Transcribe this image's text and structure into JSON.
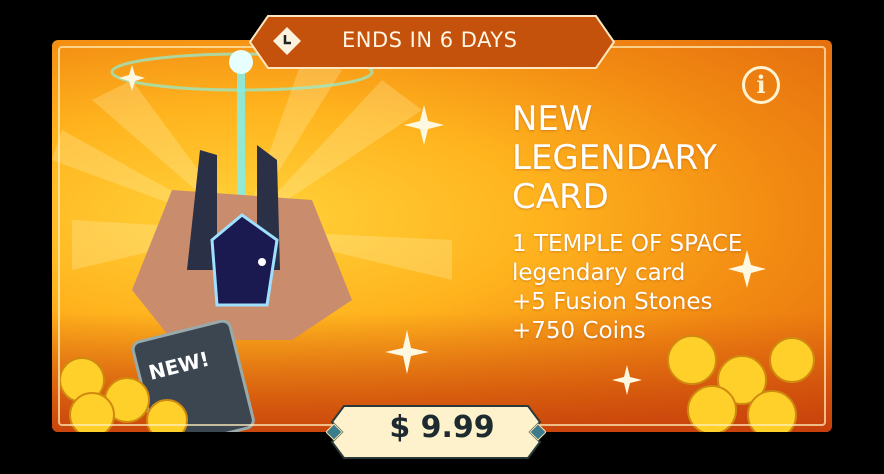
{
  "banner": {
    "icon": "clock-icon",
    "label": "ENDS IN 6 DAYS"
  },
  "offer": {
    "title": "NEW LEGENDARY CARD",
    "description_lines": [
      "1 TEMPLE OF SPACE",
      "legendary card",
      "+5 Fusion Stones",
      "+750 Coins"
    ],
    "card_badge": "NEW!"
  },
  "price": {
    "label": "$ 9.99"
  },
  "info": {
    "icon": "info-icon",
    "label": "i"
  },
  "colors": {
    "banner": "#c4520c",
    "card_top": "#ffc21e",
    "card_bottom": "#c8400e",
    "price_bg": "#fdf2cc"
  }
}
